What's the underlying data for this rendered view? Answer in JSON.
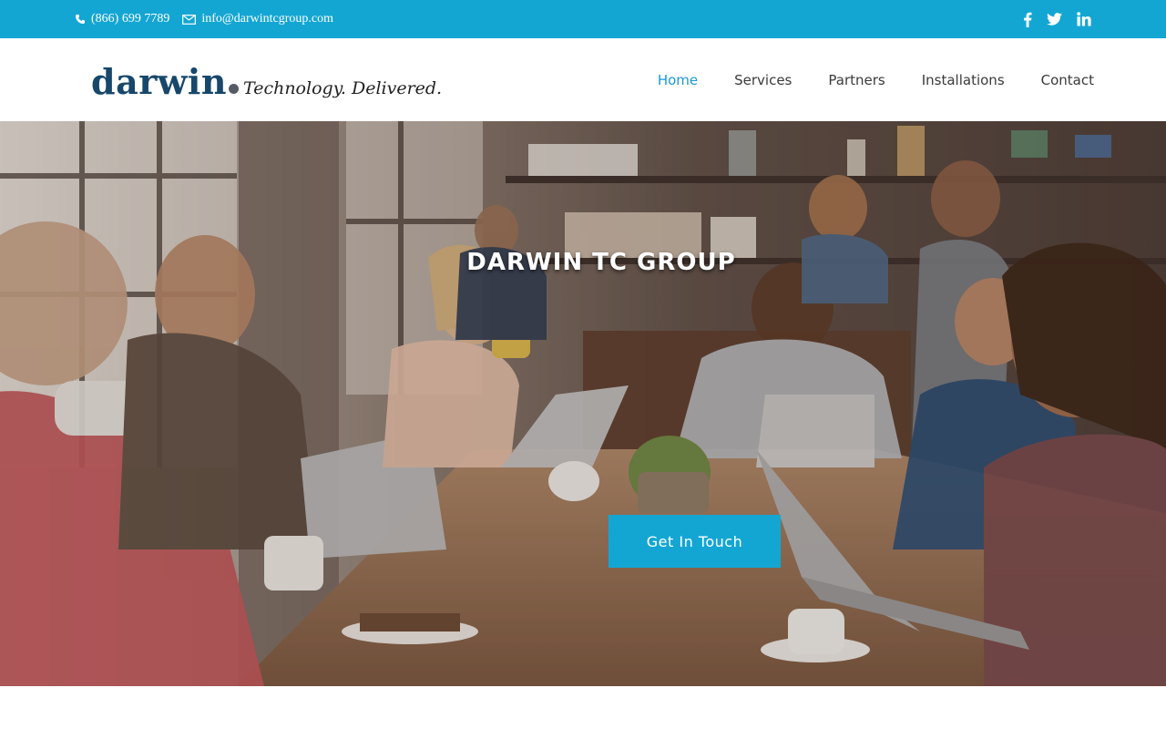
{
  "topbar": {
    "phone": "(866) 699 7789",
    "email": "info@darwintcgroup.com",
    "social": [
      "facebook-icon",
      "twitter-icon",
      "linkedin-icon"
    ],
    "background": "#14a6d3"
  },
  "logo": {
    "word": "darwin",
    "tagline": "Technology. Delivered."
  },
  "nav": {
    "items": [
      "Home",
      "Services",
      "Partners",
      "Installations",
      "Contact"
    ],
    "active": "Home",
    "active_color": "#1a9ad6"
  },
  "hero": {
    "title": "DARWIN TC GROUP",
    "cta": "Get In Touch",
    "cta_color": "#14a6d3"
  }
}
